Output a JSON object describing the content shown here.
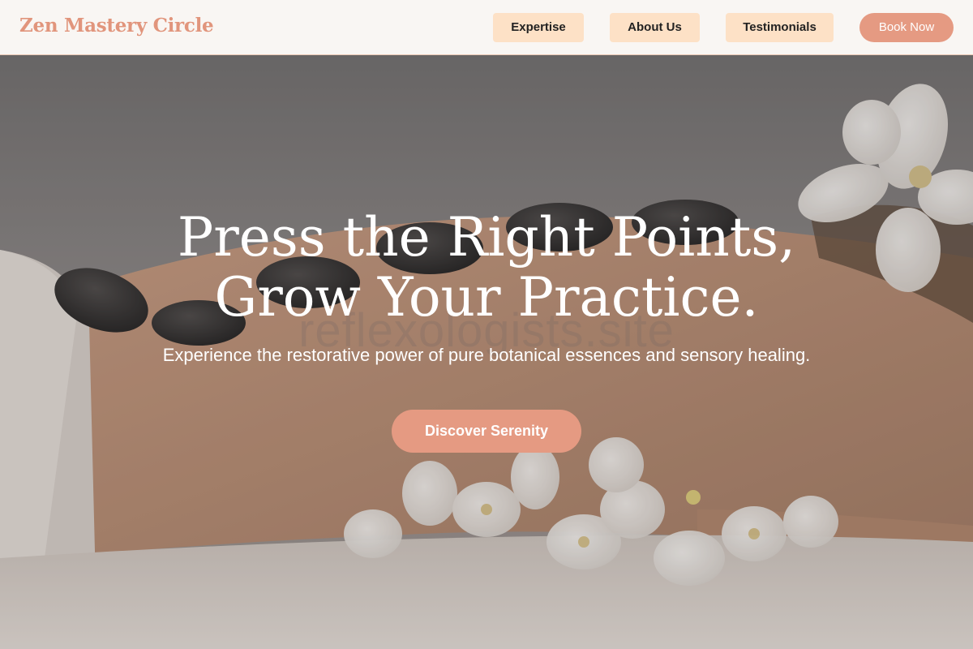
{
  "header": {
    "brand": "Zen Mastery Circle",
    "nav": [
      {
        "label": "Expertise"
      },
      {
        "label": "About Us"
      },
      {
        "label": "Testimonials"
      }
    ],
    "book_label": "Book Now"
  },
  "hero": {
    "title_line1": "Press the Right Points,",
    "title_line2": "Grow Your Practice.",
    "subtitle": "Experience the restorative power of pure botanical essences and sensory healing.",
    "cta_label": "Discover Serenity",
    "watermark": "reflexologists.site"
  },
  "colors": {
    "accent": "#e59a82",
    "nav_pill_bg": "#fde1c6",
    "header_bg": "#f9f6f3"
  }
}
